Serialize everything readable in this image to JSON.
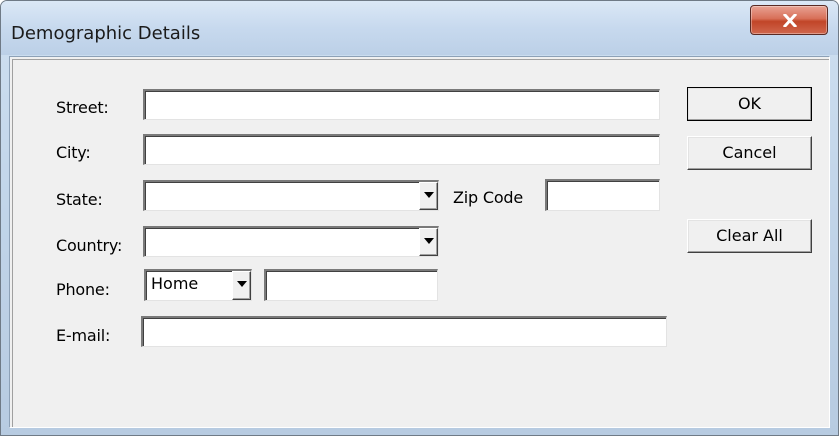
{
  "window": {
    "title": "Demographic Details"
  },
  "form": {
    "street_label": "Street:",
    "city_label": "City:",
    "state_label": "State:",
    "zip_label": "Zip Code",
    "country_label": "Country:",
    "phone_label": "Phone:",
    "email_label": "E-mail:",
    "street_value": "",
    "city_value": "",
    "state_value": "",
    "zip_value": "",
    "country_value": "",
    "phone_type_value": "Home",
    "phone_value": "",
    "email_value": ""
  },
  "buttons": {
    "ok": "OK",
    "cancel": "Cancel",
    "clear_all": "Clear All"
  },
  "icons": {
    "close": "close-icon",
    "dropdown": "chevron-down-icon"
  },
  "colors": {
    "close_button": "#c8503a",
    "dialog_bg": "#f0f0f0",
    "title_bar": "#c7d9ee"
  }
}
